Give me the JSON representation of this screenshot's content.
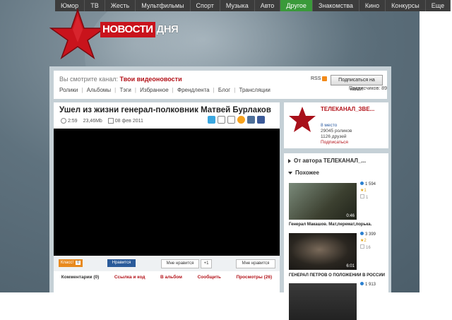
{
  "nav": {
    "items": [
      "Юмор",
      "ТВ",
      "Жесть",
      "Мультфильмы",
      "Спорт",
      "Музыка",
      "Авто",
      "Другое",
      "Знакомства",
      "Кино",
      "Конкурсы",
      "Еще"
    ],
    "active": "Другое"
  },
  "logo": {
    "part1": "НОВОСТИ",
    "part2": "ДНЯ"
  },
  "channel": {
    "watching_label": "Вы смотрите канал:",
    "name": "Твои видеоновости",
    "tabs": [
      "Ролики",
      "Альбомы",
      "Тэги",
      "Избранное",
      "Френдлента",
      "Блог",
      "Трансляции"
    ],
    "rss": "RSS",
    "subscribe": "Подписаться на канал",
    "subscribers": "Подписчиков: 89"
  },
  "video": {
    "title": "Ушел из жизни генерал-полковник Матвей Бурлаков",
    "duration": "2:59",
    "size": "23,46Mb",
    "date": "08 фев 2011"
  },
  "social": {
    "ok_label": "Класс!",
    "ok_count": "0",
    "mail_label": "Нравится",
    "vk_label": "Мне нравится",
    "plus_label": "+1",
    "fb_label": "Мне нравится"
  },
  "video_tabs": [
    "Комментарии (0)",
    "Ссылка и код",
    "В альбом",
    "Сообщить",
    "Просмотры (26)"
  ],
  "author": {
    "name": "ТЕЛЕКАНАЛ_ЗВЕ...",
    "place": "8 место",
    "videos": "29045 роликов",
    "friends": "1126 друзей",
    "subscribe": "Подписаться"
  },
  "sidebar": {
    "from_author": "От автора ТЕЛЕКАНАЛ_...",
    "similar": "Похожее"
  },
  "similar": [
    {
      "duration": "0:46",
      "views": "1 594",
      "stars": "1",
      "comments": "1",
      "title": "Генерал Макашов. Мат,перемат,порька."
    },
    {
      "duration": "6:01",
      "views": "3 399",
      "stars": "2",
      "comments": "16",
      "title": "ГЕНЕРАЛ ПЕТРОВ О ПОЛОЖЕНИИ В РОССИИ"
    },
    {
      "duration": "",
      "views": "1 913",
      "stars": "3",
      "comments": "",
      "title": ""
    }
  ],
  "colors": {
    "accent": "#b3131a",
    "nav_active": "#3a9a3a",
    "nav_bg": "#3c3c3c"
  }
}
